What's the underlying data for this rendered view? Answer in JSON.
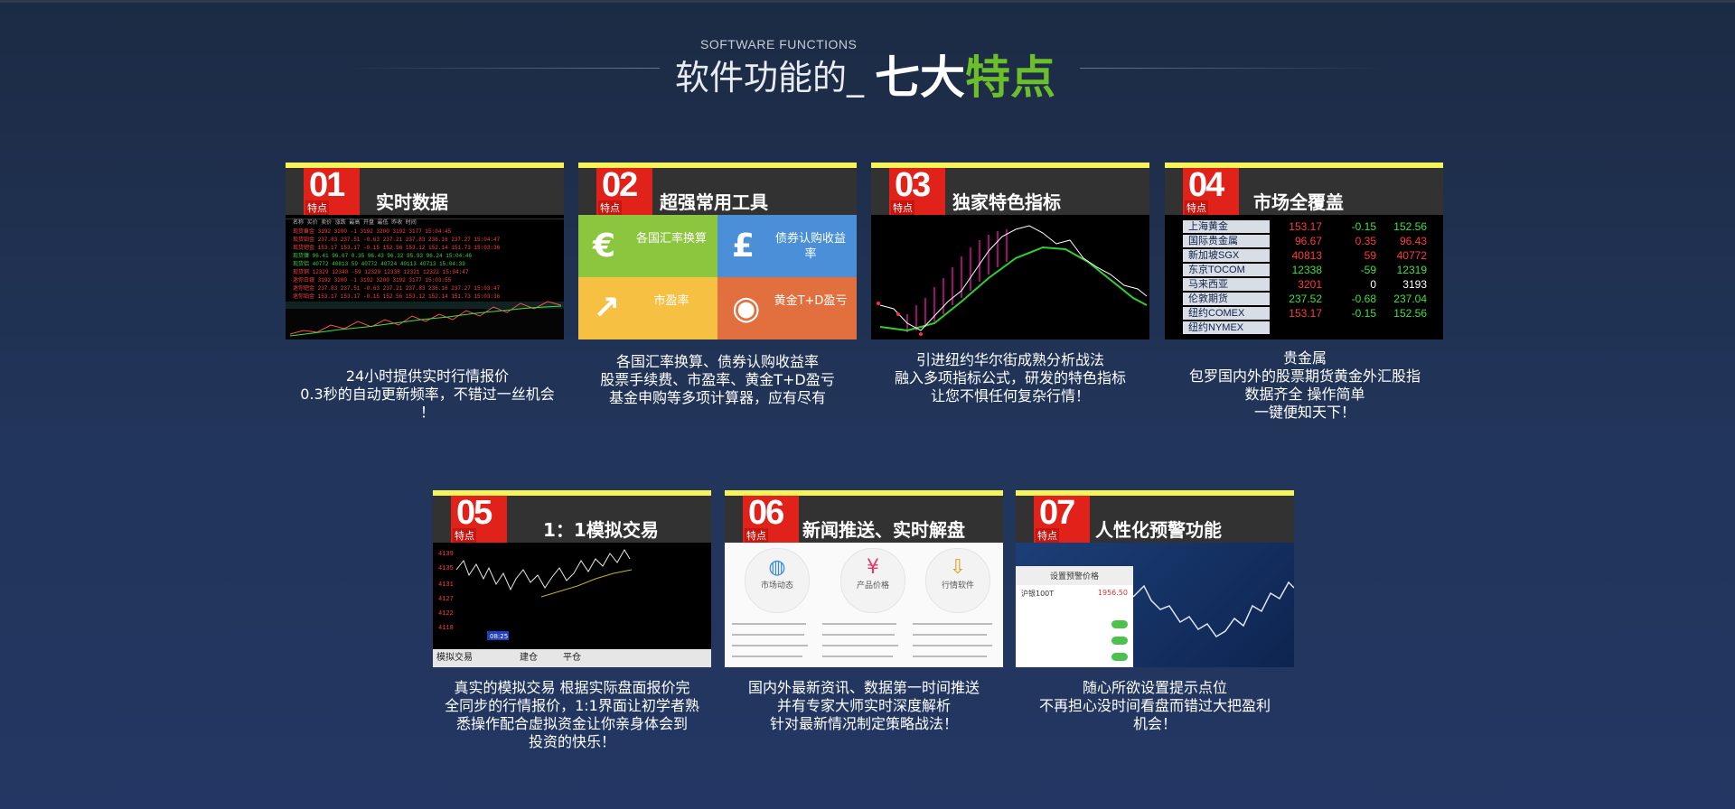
{
  "header": {
    "subtitle_en": "SOFTWARE FUNCTIONS",
    "title_prefix": "软件功能的_",
    "title_white": "七大",
    "title_green": "特点"
  },
  "badge_tag": "特点",
  "features": [
    {
      "num": "01",
      "title": "实时数据",
      "desc": [
        "24小时提供实时行情报价",
        "0.3秒的自动更新频率，不错过一丝机会",
        "！"
      ]
    },
    {
      "num": "02",
      "title": "超强常用工具",
      "desc": [
        "各国汇率换算、债券认购收益率",
        "股票手续费、市盈率、黄金T+D盈亏",
        "基金申购等多项计算器，应有尽有"
      ]
    },
    {
      "num": "03",
      "title": "独家特色指标",
      "desc": [
        "引进纽约华尔街成熟分析战法",
        "融入多项指标公式，研发的特色指标",
        "让您不惧任何复杂行情！"
      ]
    },
    {
      "num": "04",
      "title": "市场全覆盖",
      "desc": [
        "贵金属",
        "包罗国内外的股票期货黄金外汇股指",
        "数据齐全  操作简单",
        "一键便知天下！"
      ]
    },
    {
      "num": "05",
      "title": "1：1模拟交易",
      "desc": [
        "真实的模拟交易 根据实际盘面报价完",
        "全同步的行情报价，1:1界面让初学者熟",
        "悉操作配合虚拟资金让你亲身体会到",
        "投资的快乐！"
      ]
    },
    {
      "num": "06",
      "title": "新闻推送、实时解盘",
      "desc": [
        "国内外最新资讯、数据第一时间推送",
        "并有专家大师实时深度解析",
        "针对最新情况制定策略战法！"
      ]
    },
    {
      "num": "07",
      "title": "人性化预警功能",
      "desc": [
        "随心所欲设置提示点位",
        "不再担心没时间看盘而错过大把盈利",
        "机会！"
      ]
    }
  ],
  "tools": [
    {
      "label": "各国汇率换算",
      "icon": "euro-icon",
      "glyph": "€",
      "color": "#8cc63f"
    },
    {
      "label": "债券认购收益率",
      "icon": "moneybag-icon",
      "glyph": "£",
      "color": "#4a8fd8"
    },
    {
      "label": "市盈率",
      "icon": "trend-icon",
      "glyph": "↗",
      "color": "#f6c043"
    },
    {
      "label": "黄金T+D盈亏",
      "icon": "coins-icon",
      "glyph": "◉",
      "color": "#e2703f"
    }
  ],
  "markets": [
    {
      "name": "上海黄金",
      "v1": "153.17",
      "v2": "-0.15",
      "v3": "152.56"
    },
    {
      "name": "国际贵金属",
      "v1": "96.67",
      "v2": "0.35",
      "v3": "96.43"
    },
    {
      "name": "新加坡SGX",
      "v1": "40813",
      "v2": "59",
      "v3": "40772"
    },
    {
      "name": "东京TOCOM",
      "v1": "12338",
      "v2": "-59",
      "v3": "12319"
    },
    {
      "name": "马来西亚",
      "v1": "3201",
      "v2": "0",
      "v3": "3193"
    },
    {
      "name": "伦敦期货",
      "v1": "237.52",
      "v2": "-0.68",
      "v3": "237.04"
    },
    {
      "name": "纽约COMEX",
      "v1": "153.17",
      "v2": "-0.15",
      "v3": "152.56"
    },
    {
      "name": "纽约NYMEX",
      "v1": "",
      "v2": "",
      "v3": ""
    }
  ],
  "sim": {
    "footer_left": "模拟交易",
    "buy": "建仓",
    "close": "平仓",
    "time": "08:25"
  },
  "news_icons": [
    {
      "label": "市场动态",
      "icon": "globe-icon",
      "glyph": "◍"
    },
    {
      "label": "产品价格",
      "icon": "yen-icon",
      "glyph": "¥"
    },
    {
      "label": "行情软件",
      "icon": "download-icon",
      "glyph": "⇩"
    }
  ],
  "alert": {
    "panel_title": "设置预警价格",
    "symbol": "沪银100T",
    "price": "1956.50"
  },
  "colors": {
    "accent_green": "#6cbf2a",
    "badge_red": "#e0221a",
    "strip_yellow": "#f7f45a"
  }
}
